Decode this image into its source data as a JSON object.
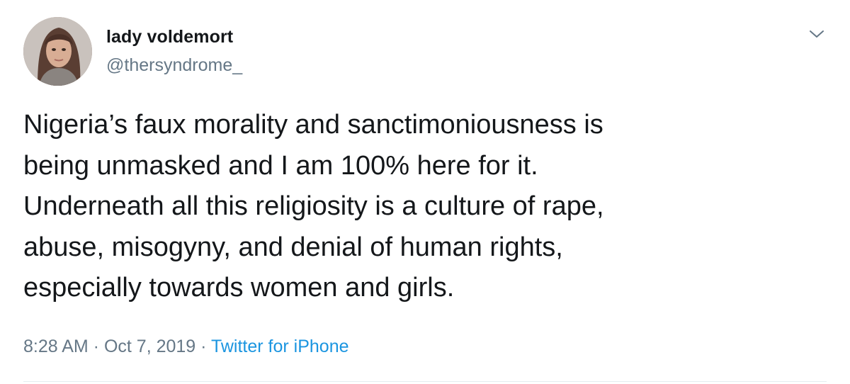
{
  "tweet": {
    "author": {
      "display_name": "lady voldemort",
      "handle": "@thersyndrome_"
    },
    "text_lines": [
      "Nigeria’s faux morality and sanctimoniousness is",
      "being unmasked and I am 100% here for it.",
      "Underneath all this religiosity is a culture of rape,",
      "abuse, misogyny, and denial of human rights,",
      "especially towards women and girls."
    ],
    "time": "8:28 AM",
    "separator": " · ",
    "date": "Oct 7, 2019",
    "source": "Twitter for iPhone"
  },
  "icons": {
    "menu": "chevron-down-icon"
  },
  "colors": {
    "text": "#14171a",
    "secondary": "#657786",
    "link": "#1b95e0",
    "divider": "#e6ecf0"
  }
}
